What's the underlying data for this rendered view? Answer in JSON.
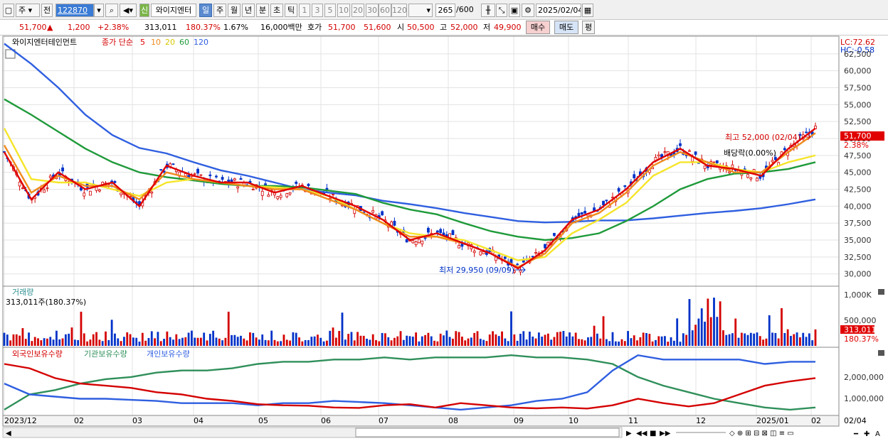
{
  "toolbar": {
    "tab_stock": "주",
    "tab_prev": "전",
    "code": "122870",
    "badge_new": "신",
    "name": "와이지엔터",
    "periods": [
      "일",
      "주",
      "월",
      "년",
      "분",
      "초",
      "틱"
    ],
    "nums": [
      "1",
      "3",
      "5",
      "10",
      "20",
      "30",
      "60",
      "120"
    ],
    "count": "265",
    "total": "/600",
    "date": "2025/02/04"
  },
  "quote": {
    "price": "51,700",
    "price_arrow": "▲",
    "change": "1,200",
    "change_pct": "+2.38%",
    "volume": "313,011",
    "vol_ratio": "180.37%",
    "turnover": "1.67%",
    "amount": "16,000백만",
    "bid_label": "호가",
    "ask": "51,700",
    "bid": "51,600",
    "open_label": "시",
    "open": "50,500",
    "high_label": "고",
    "high": "52,000",
    "low_label": "저",
    "low": "49,900",
    "buy_button": "매수",
    "sell_button": "매도",
    "eval_button": "평"
  },
  "price_panel": {
    "stock_name": "와이지엔터테인먼트",
    "ma_label": "종가 단순",
    "ma_periods": [
      "5",
      "10",
      "20",
      "60",
      "120"
    ],
    "lc": "LC:72.62",
    "hc": "HC:-0.58",
    "y_ticks": [
      "62,500",
      "60,000",
      "57,500",
      "55,000",
      "52,500",
      "50,000",
      "47,500",
      "45,000",
      "42,500",
      "40,000",
      "37,500",
      "35,000",
      "32,500",
      "30,000"
    ],
    "cur_price": "51,700",
    "cur_pct": "2.38%",
    "high_note": "최고 52,000 (02/04)",
    "low_note": "최저 29,950 (09/09)",
    "dividend": "배당락(0.00%)"
  },
  "volume_panel": {
    "title": "거래량",
    "info": "313,011주(180.37%)",
    "y_ticks": [
      "1,000K",
      "500,000"
    ],
    "cur": "313,011",
    "cur_pct": "180.37%"
  },
  "holding_panel": {
    "legend": [
      "외국인보유수량",
      "기관보유수량",
      "개인보유수량"
    ],
    "y_ticks": [
      "2,000,000",
      "1,000,000"
    ]
  },
  "x_axis": {
    "labels": [
      "2023/12",
      "02",
      "03",
      "04",
      "05",
      "06",
      "07",
      "08",
      "09",
      "10",
      "11",
      "12",
      "2025/01",
      "02"
    ],
    "right_label": "02/04"
  },
  "colors": {
    "ma5": "#e00000",
    "ma10": "#f08a1c",
    "ma20": "#f5e52a",
    "ma60": "#1f9a3a",
    "ma120": "#2f5fe0",
    "up": "#d40000",
    "down": "#0032c8",
    "foreign": "#d40000",
    "inst": "#2f8f5a",
    "indiv": "#2f5fe0"
  },
  "chart_data": {
    "type": "line",
    "ylim": [
      28500,
      65000
    ],
    "x": [
      "2023/12",
      "02",
      "03",
      "04",
      "05",
      "06",
      "07",
      "08",
      "09",
      "10",
      "11",
      "12",
      "2025/01",
      "02"
    ],
    "series": [
      {
        "name": "5",
        "values": [
          48000,
          41000,
          45000,
          42500,
          43500,
          40000,
          46000,
          44500,
          43500,
          43500,
          42000,
          43000,
          41500,
          40000,
          38000,
          35000,
          36000,
          34500,
          33000,
          30800,
          33500,
          38000,
          39500,
          42500,
          46500,
          48500,
          46000,
          45500,
          44500,
          48500,
          51500
        ]
      },
      {
        "name": "10",
        "values": [
          49000,
          42000,
          44500,
          43000,
          43000,
          41000,
          45000,
          44000,
          43500,
          43000,
          42500,
          42500,
          41000,
          39500,
          37500,
          35500,
          35500,
          34500,
          33000,
          31000,
          33000,
          37500,
          39000,
          42000,
          46000,
          48000,
          46500,
          45000,
          45000,
          48000,
          50800
        ]
      },
      {
        "name": "20",
        "values": [
          51500,
          44000,
          43500,
          43500,
          42500,
          41500,
          43500,
          44000,
          43500,
          43000,
          42800,
          42500,
          41500,
          39500,
          37500,
          36000,
          35500,
          35000,
          33500,
          32000,
          32500,
          36000,
          38000,
          40500,
          44500,
          46500,
          46500,
          45500,
          45000,
          46500,
          47500
        ]
      },
      {
        "name": "60",
        "values": [
          55800,
          53500,
          51000,
          48500,
          46500,
          45000,
          44300,
          43800,
          43300,
          43000,
          43000,
          42800,
          42300,
          41800,
          40500,
          39500,
          38800,
          37500,
          36300,
          35500,
          35000,
          35300,
          36000,
          37800,
          40000,
          42500,
          44000,
          44800,
          45000,
          45500,
          46500
        ]
      },
      {
        "name": "120",
        "values": [
          64000,
          61000,
          57500,
          53500,
          50500,
          48600,
          47800,
          46500,
          45300,
          44500,
          43500,
          42500,
          42000,
          41600,
          40800,
          40300,
          39700,
          39000,
          38400,
          37800,
          37600,
          37700,
          37900,
          37900,
          38200,
          38600,
          39000,
          39300,
          39700,
          40300,
          41000
        ]
      }
    ]
  }
}
